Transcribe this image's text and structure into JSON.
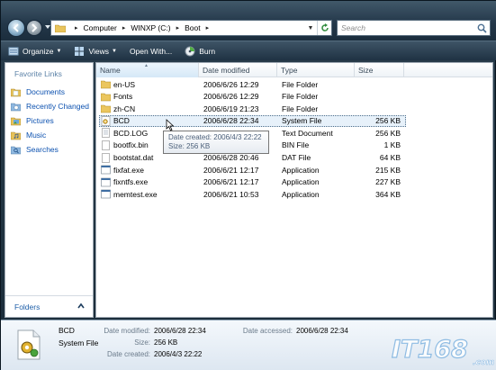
{
  "address": {
    "crumbs": [
      "Computer",
      "WINXP (C:)",
      "Boot"
    ],
    "search_placeholder": "Search"
  },
  "toolbar": {
    "organize": "Organize",
    "views": "Views",
    "open_with": "Open With...",
    "burn": "Burn"
  },
  "favorites": {
    "title": "Favorite Links",
    "items": [
      {
        "label": "Documents",
        "icon": "documents-icon"
      },
      {
        "label": "Recently Changed",
        "icon": "recently-changed-icon"
      },
      {
        "label": "Pictures",
        "icon": "pictures-icon"
      },
      {
        "label": "Music",
        "icon": "music-icon"
      },
      {
        "label": "Searches",
        "icon": "searches-icon"
      }
    ],
    "folders_label": "Folders"
  },
  "columns": {
    "name": "Name",
    "date": "Date modified",
    "type": "Type",
    "size": "Size"
  },
  "files": [
    {
      "name": "en-US",
      "date": "2006/6/26 12:29",
      "type": "File Folder",
      "size": "",
      "icon": "folder-icon"
    },
    {
      "name": "Fonts",
      "date": "2006/6/26 12:29",
      "type": "File Folder",
      "size": "",
      "icon": "folder-icon"
    },
    {
      "name": "zh-CN",
      "date": "2006/6/19 21:23",
      "type": "File Folder",
      "size": "",
      "icon": "folder-icon"
    },
    {
      "name": "BCD",
      "date": "2006/6/28 22:34",
      "type": "System File",
      "size": "256 KB",
      "icon": "system-file-icon"
    },
    {
      "name": "BCD.LOG",
      "date": "",
      "type": "Text Document",
      "size": "256 KB",
      "icon": "text-file-icon"
    },
    {
      "name": "bootfix.bin",
      "date": "",
      "type": "BIN File",
      "size": "1 KB",
      "icon": "bin-file-icon"
    },
    {
      "name": "bootstat.dat",
      "date": "2006/6/28 20:46",
      "type": "DAT File",
      "size": "64 KB",
      "icon": "dat-file-icon"
    },
    {
      "name": "fixfat.exe",
      "date": "2006/6/21 12:17",
      "type": "Application",
      "size": "215 KB",
      "icon": "application-icon"
    },
    {
      "name": "fixntfs.exe",
      "date": "2006/6/21 12:17",
      "type": "Application",
      "size": "227 KB",
      "icon": "application-icon"
    },
    {
      "name": "memtest.exe",
      "date": "2006/6/21 10:53",
      "type": "Application",
      "size": "364 KB",
      "icon": "application-icon"
    }
  ],
  "tooltip": {
    "line1": "Date created: 2006/4/3 22:22",
    "line2": "Size: 256 KB"
  },
  "details": {
    "name": "BCD",
    "type": "System File",
    "date_modified_label": "Date modified:",
    "date_modified": "2006/6/28 22:34",
    "size_label": "Size:",
    "size": "256 KB",
    "date_created_label": "Date created:",
    "date_created": "2006/4/3 22:22",
    "date_accessed_label": "Date accessed:",
    "date_accessed": "2006/6/28 22:34"
  },
  "watermark": {
    "brand": "IT168",
    "suffix": ".com"
  }
}
